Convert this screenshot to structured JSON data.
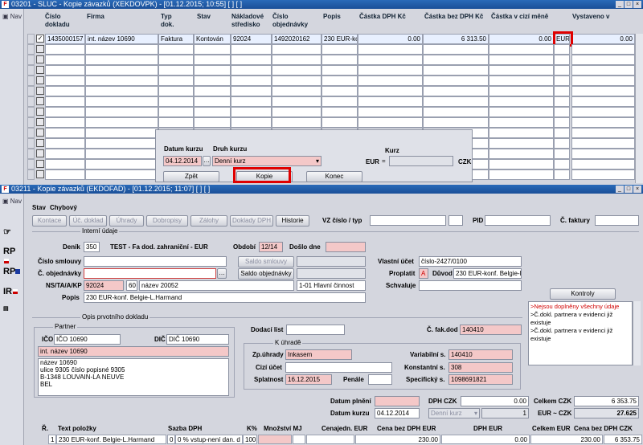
{
  "win1": {
    "title": "03201 - SLUC - Kopie závazků (XEKDOVPK) - [01.12.2015; 10:55] [ ] [ ]",
    "nav": "Nav",
    "headers": [
      "Číslo dokladu",
      "Firma",
      "Typ dok.",
      "Stav",
      "Nákladové středisko",
      "Číslo objednávky",
      "Popis",
      "Částka DPH Kč",
      "Částka bez DPH Kč",
      "Částka v cizí měně",
      "Vystaveno v"
    ],
    "row": {
      "cislo": "1435000157",
      "firma": "int. název 10690",
      "typ": "Faktura",
      "stav": "Kontován",
      "stredisko": "92024",
      "objednavka": "1492020162",
      "popis": "230 EUR-kon",
      "dph": "0.00",
      "bez_dph": "6 313.50",
      "cizi": "0.00",
      "mena": "EUR",
      "vystaveno": "0.00"
    }
  },
  "dialog": {
    "datum_label": "Datum kurzu",
    "datum_value": "04.12.2014",
    "druh_label": "Druh kurzu",
    "druh_value": "Denní kurz",
    "kurz_label": "Kurz",
    "kurz_eur": "EUR",
    "kurz_eq": "=",
    "kurz_czk": "CZK",
    "zpet": "Zpět",
    "kopie": "Kopie",
    "konec": "Konec"
  },
  "win2": {
    "title": "03211 - Kopie závazků (EKDOFAD) - [01.12.2015; 11:07] [ ] [ ]",
    "nav": "Nav",
    "stav_label": "Stav",
    "stav_value": "Chybový",
    "tabs": [
      "Kontace",
      "Úč. doklad",
      "Úhrady",
      "Dobropisy",
      "Zálohy",
      "Doklady DPH",
      "Historie"
    ],
    "vz_label": "VZ číslo / typ",
    "pid_label": "PID",
    "cfaktury_label": "Č. faktury",
    "interni_label": "Interní údaje",
    "denik_label": "Deník",
    "denik_value": "350",
    "denik_text": "TEST - Fa dod. zahraniční - EUR",
    "obdobi_label": "Období",
    "obdobi_value": "12/14",
    "doslo_label": "Došlo dne",
    "cislo_smlouvy_label": "Číslo smlouvy",
    "saldo_smlouvy": "Saldo smlouvy",
    "saldo_objednavky": "Saldo objednávky",
    "vlastni_ucet_label": "Vlastní účet",
    "vlastni_ucet_value": "číslo-2427/0100",
    "c_objednavky_label": "Č. objednávky",
    "proplatit_label": "Proplatit",
    "proplatit_value": "A",
    "duvod_label": "Důvod",
    "duvod_value": "230 EUR-konf. Belgie-L.I",
    "nsta_label": "NS/TA/A/KP",
    "ns_value": "92024",
    "ta_value": "60",
    "ta_name": "název 20052",
    "kp_value": "1-01 Hlavní činnost",
    "schvaluje_label": "Schvaluje",
    "popis_label": "Popis",
    "popis_value": "230 EUR-konf. Belgie-L.Harmand",
    "kontroly": "Kontroly",
    "messages": [
      ">Nejsou doplněny všechny údaje",
      ">Č.dokl. partnera v evidenci již existuje",
      ">Č.dokl. partnera v evidenci již existuje"
    ],
    "opis_label": "Opis prvotního dokladu",
    "partner_label": "Partner",
    "ico_label": "IČO",
    "ico_value": "IČO 10690",
    "dic_label": "DIČ",
    "dic_value": "DIČ 10690",
    "partner_name": "int. název 10690",
    "address": [
      "název 10690",
      "ulice 9305 číslo popisné 9305",
      "B-1348 LOUVAIN-LA NEUVE",
      "BEL"
    ],
    "dodaci_label": "Dodací list",
    "cfakdod_label": "Č. fak.dod",
    "cfakdod_value": "140410",
    "k_uhrade_label": "K úhradě",
    "zpuhrady_label": "Zp.úhrady",
    "zpuhrady_value": "Inkasem",
    "variabilni_label": "Variabilní s.",
    "variabilni_value": "140410",
    "cizi_ucet_label": "Cizí účet",
    "konstantni_label": "Konstantní s.",
    "konstantni_value": "308",
    "splatnost_label": "Splatnost",
    "splatnost_value": "16.12.2015",
    "penale_label": "Penále",
    "specificky_label": "Specifický s.",
    "specificky_value": "1098691821",
    "datum_plneni_label": "Datum plnění",
    "dph_czk_label": "DPH CZK",
    "dph_czk_value": "0.00",
    "celkem_czk_label": "Celkem CZK",
    "celkem_czk_value": "6 353.75",
    "datum_kurzu_label": "Datum kurzu",
    "datum_kurzu_value": "04.12.2014",
    "druh_kurzu_value": "Denní kurz",
    "kurz_value": "1",
    "eur_czk_label": "EUR ~ CZK",
    "eur_czk_value": "27.625",
    "item_headers": [
      "Ř.",
      "Text položky",
      "Sazba DPH",
      "K%",
      "Množství MJ",
      "Cenajedn. EUR",
      "Cena bez DPH EUR",
      "DPH EUR",
      "Celkem EUR",
      "Cena bez DPH CZK"
    ],
    "item_row": {
      "r": "1",
      "text": "230 EUR-konf. Belgie-L.Harmand",
      "sazba": "0",
      "sazba_text": "0 % vstup-není dan. d",
      "k": "100",
      "cena_bez": "230.00",
      "dph": "0.00",
      "celkem": "230.00",
      "cena_czk": "6 353.75"
    }
  }
}
